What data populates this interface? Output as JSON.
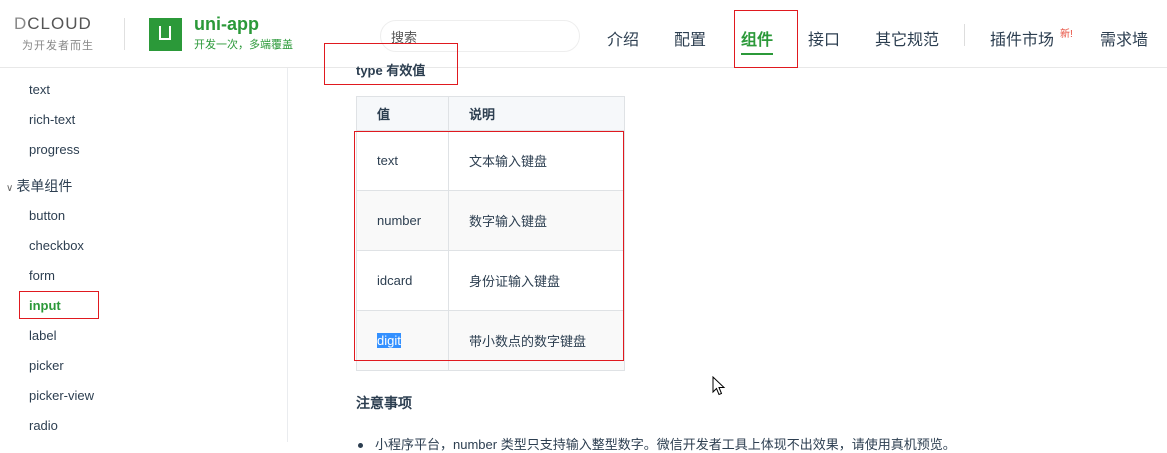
{
  "header": {
    "dcloud": {
      "brand_d": "D",
      "brand_rest": "CLOUD",
      "tagline": "为开发者而生"
    },
    "uniapp": {
      "name": "uni-app",
      "tagline": "开发一次，多端覆盖"
    },
    "search": {
      "placeholder": "搜索",
      "value": ""
    },
    "nav": [
      {
        "label": "介绍"
      },
      {
        "label": "配置"
      },
      {
        "label": "组件",
        "active": true
      },
      {
        "label": "接口"
      },
      {
        "label": "其它规范"
      },
      {
        "label": "插件市场"
      },
      {
        "label": "需求墙"
      }
    ],
    "new_badge": "新!"
  },
  "sidebar": {
    "items_top": [
      "text",
      "rich-text",
      "progress"
    ],
    "group": {
      "label": "表单组件",
      "expanded": true
    },
    "items_form": [
      "button",
      "checkbox",
      "form",
      "input",
      "label",
      "picker",
      "picker-view",
      "radio"
    ],
    "active_item": "input"
  },
  "main": {
    "section_heading": "type 有效值",
    "table": {
      "headers": [
        "值",
        "说明"
      ],
      "rows": [
        {
          "value": "text",
          "desc": "文本输入键盘"
        },
        {
          "value": "number",
          "desc": "数字输入键盘"
        },
        {
          "value": "idcard",
          "desc": "身份证输入键盘"
        },
        {
          "value": "digit",
          "desc": "带小数点的数字键盘",
          "selected": true
        }
      ]
    },
    "notes_title": "注意事项",
    "note_1": "小程序平台，number 类型只支持输入整型数字。微信开发者工具上体现不出效果，请使用真机预览。"
  },
  "colors": {
    "brand_green": "#2b9939",
    "annotation_red": "#e0191f",
    "selection_blue": "#3390ff"
  }
}
